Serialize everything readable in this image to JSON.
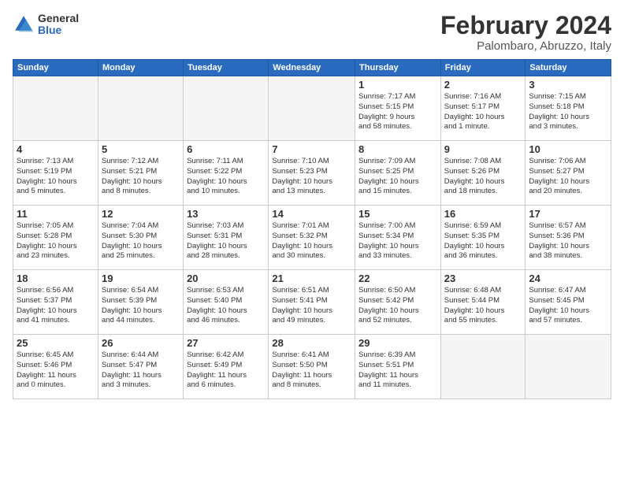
{
  "logo": {
    "general": "General",
    "blue": "Blue"
  },
  "title": "February 2024",
  "subtitle": "Palombaro, Abruzzo, Italy",
  "headers": [
    "Sunday",
    "Monday",
    "Tuesday",
    "Wednesday",
    "Thursday",
    "Friday",
    "Saturday"
  ],
  "weeks": [
    [
      {
        "day": "",
        "info": ""
      },
      {
        "day": "",
        "info": ""
      },
      {
        "day": "",
        "info": ""
      },
      {
        "day": "",
        "info": ""
      },
      {
        "day": "1",
        "info": "Sunrise: 7:17 AM\nSunset: 5:15 PM\nDaylight: 9 hours\nand 58 minutes."
      },
      {
        "day": "2",
        "info": "Sunrise: 7:16 AM\nSunset: 5:17 PM\nDaylight: 10 hours\nand 1 minute."
      },
      {
        "day": "3",
        "info": "Sunrise: 7:15 AM\nSunset: 5:18 PM\nDaylight: 10 hours\nand 3 minutes."
      }
    ],
    [
      {
        "day": "4",
        "info": "Sunrise: 7:13 AM\nSunset: 5:19 PM\nDaylight: 10 hours\nand 5 minutes."
      },
      {
        "day": "5",
        "info": "Sunrise: 7:12 AM\nSunset: 5:21 PM\nDaylight: 10 hours\nand 8 minutes."
      },
      {
        "day": "6",
        "info": "Sunrise: 7:11 AM\nSunset: 5:22 PM\nDaylight: 10 hours\nand 10 minutes."
      },
      {
        "day": "7",
        "info": "Sunrise: 7:10 AM\nSunset: 5:23 PM\nDaylight: 10 hours\nand 13 minutes."
      },
      {
        "day": "8",
        "info": "Sunrise: 7:09 AM\nSunset: 5:25 PM\nDaylight: 10 hours\nand 15 minutes."
      },
      {
        "day": "9",
        "info": "Sunrise: 7:08 AM\nSunset: 5:26 PM\nDaylight: 10 hours\nand 18 minutes."
      },
      {
        "day": "10",
        "info": "Sunrise: 7:06 AM\nSunset: 5:27 PM\nDaylight: 10 hours\nand 20 minutes."
      }
    ],
    [
      {
        "day": "11",
        "info": "Sunrise: 7:05 AM\nSunset: 5:28 PM\nDaylight: 10 hours\nand 23 minutes."
      },
      {
        "day": "12",
        "info": "Sunrise: 7:04 AM\nSunset: 5:30 PM\nDaylight: 10 hours\nand 25 minutes."
      },
      {
        "day": "13",
        "info": "Sunrise: 7:03 AM\nSunset: 5:31 PM\nDaylight: 10 hours\nand 28 minutes."
      },
      {
        "day": "14",
        "info": "Sunrise: 7:01 AM\nSunset: 5:32 PM\nDaylight: 10 hours\nand 30 minutes."
      },
      {
        "day": "15",
        "info": "Sunrise: 7:00 AM\nSunset: 5:34 PM\nDaylight: 10 hours\nand 33 minutes."
      },
      {
        "day": "16",
        "info": "Sunrise: 6:59 AM\nSunset: 5:35 PM\nDaylight: 10 hours\nand 36 minutes."
      },
      {
        "day": "17",
        "info": "Sunrise: 6:57 AM\nSunset: 5:36 PM\nDaylight: 10 hours\nand 38 minutes."
      }
    ],
    [
      {
        "day": "18",
        "info": "Sunrise: 6:56 AM\nSunset: 5:37 PM\nDaylight: 10 hours\nand 41 minutes."
      },
      {
        "day": "19",
        "info": "Sunrise: 6:54 AM\nSunset: 5:39 PM\nDaylight: 10 hours\nand 44 minutes."
      },
      {
        "day": "20",
        "info": "Sunrise: 6:53 AM\nSunset: 5:40 PM\nDaylight: 10 hours\nand 46 minutes."
      },
      {
        "day": "21",
        "info": "Sunrise: 6:51 AM\nSunset: 5:41 PM\nDaylight: 10 hours\nand 49 minutes."
      },
      {
        "day": "22",
        "info": "Sunrise: 6:50 AM\nSunset: 5:42 PM\nDaylight: 10 hours\nand 52 minutes."
      },
      {
        "day": "23",
        "info": "Sunrise: 6:48 AM\nSunset: 5:44 PM\nDaylight: 10 hours\nand 55 minutes."
      },
      {
        "day": "24",
        "info": "Sunrise: 6:47 AM\nSunset: 5:45 PM\nDaylight: 10 hours\nand 57 minutes."
      }
    ],
    [
      {
        "day": "25",
        "info": "Sunrise: 6:45 AM\nSunset: 5:46 PM\nDaylight: 11 hours\nand 0 minutes."
      },
      {
        "day": "26",
        "info": "Sunrise: 6:44 AM\nSunset: 5:47 PM\nDaylight: 11 hours\nand 3 minutes."
      },
      {
        "day": "27",
        "info": "Sunrise: 6:42 AM\nSunset: 5:49 PM\nDaylight: 11 hours\nand 6 minutes."
      },
      {
        "day": "28",
        "info": "Sunrise: 6:41 AM\nSunset: 5:50 PM\nDaylight: 11 hours\nand 8 minutes."
      },
      {
        "day": "29",
        "info": "Sunrise: 6:39 AM\nSunset: 5:51 PM\nDaylight: 11 hours\nand 11 minutes."
      },
      {
        "day": "",
        "info": ""
      },
      {
        "day": "",
        "info": ""
      }
    ]
  ]
}
